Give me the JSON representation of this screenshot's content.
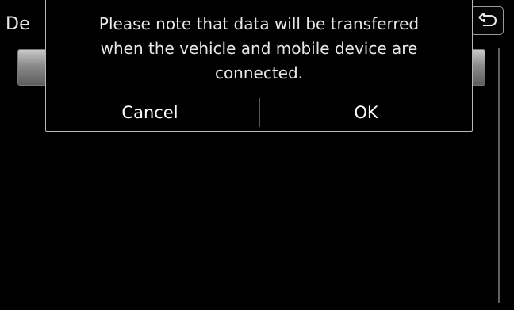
{
  "background": {
    "title_fragment": "De"
  },
  "dialog": {
    "message_lines": [
      "Please note that data will be transferred",
      "when the vehicle and mobile device are",
      "connected."
    ],
    "cancel_label": "Cancel",
    "ok_label": "OK"
  },
  "icons": {
    "back": "back-arrow-icon"
  }
}
